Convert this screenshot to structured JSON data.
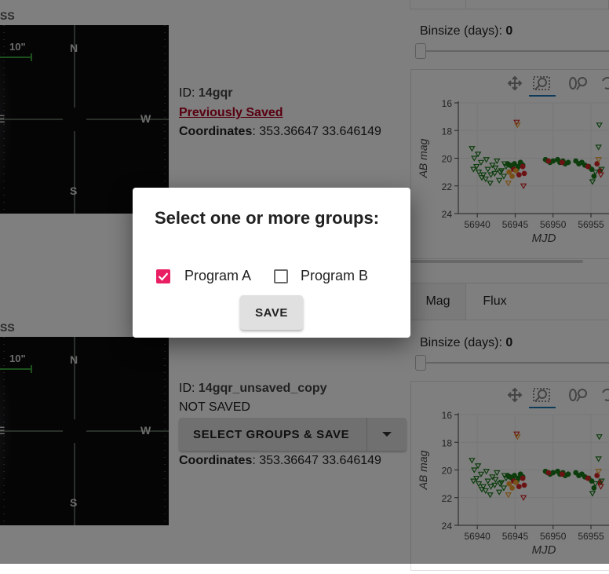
{
  "sources": [
    {
      "thumb_label": "SS",
      "scale_label": "10\"",
      "compass": {
        "n": "N",
        "s": "S",
        "w": "W",
        "e": "E"
      },
      "id_label": "ID:",
      "id_value": "14gqr",
      "status": "Previously Saved",
      "coords_label": "Coordinates",
      "coords_value": ": 353.36647 33.646149"
    },
    {
      "thumb_label": "SS",
      "scale_label": "10\"",
      "compass": {
        "n": "N",
        "s": "S",
        "w": "W",
        "e": "E"
      },
      "id_label": "ID:",
      "id_value": "14gqr_unsaved_copy",
      "status": "NOT SAVED",
      "button_label": "SELECT GROUPS & SAVE",
      "coords_label": "Coordinates",
      "coords_value": ": 353.36647 33.646149"
    }
  ],
  "photometry": [
    {
      "binsize_label": "Binsize (days):",
      "binsize_value": "0",
      "tabs": [],
      "xlabel": "MJD",
      "ylabel": "AB mag"
    },
    {
      "binsize_label": "Binsize (days):",
      "binsize_value": "0",
      "tabs": [
        "Mag",
        "Flux"
      ],
      "xlabel": "MJD",
      "ylabel": "AB mag"
    }
  ],
  "toolbar_icons": [
    "pan-icon",
    "box-zoom-icon",
    "wheel-zoom-icon",
    "reset-icon"
  ],
  "chart_data": {
    "type": "scatter",
    "xlabel": "MJD",
    "ylabel": "AB mag",
    "xlim": [
      56937.5,
      56958
    ],
    "ylim": [
      24,
      16
    ],
    "xticks": [
      56940,
      56945,
      56950,
      56955
    ],
    "yticks": [
      16,
      18,
      20,
      22,
      24
    ],
    "series": [
      {
        "color": "#1b7a1b",
        "marker": "circle",
        "x": [
          56944.0,
          56944.3,
          56944.6,
          56944.9,
          56945.2,
          56945.4,
          56945.7,
          56946.0,
          56949.0,
          56949.3,
          56949.6,
          56950.0,
          56950.6,
          56950.9,
          56951.3,
          56951.6,
          56952.0,
          56953.0,
          56953.4,
          56953.8,
          56954.2,
          56954.7,
          56955.1,
          56955.4
        ],
        "y": [
          20.4,
          20.5,
          20.6,
          20.4,
          20.8,
          20.6,
          20.3,
          20.5,
          20.1,
          20.2,
          20.3,
          20.2,
          20.1,
          20.3,
          20.2,
          20.4,
          20.3,
          20.2,
          20.4,
          20.3,
          20.5,
          20.6,
          20.8,
          21.3
        ]
      },
      {
        "color": "#d62728",
        "marker": "circle",
        "x": [
          56944.8,
          56945.5,
          56946.0,
          56946.2,
          56949.4,
          56951.2,
          56954.6,
          56955.8,
          56956.2
        ],
        "y": [
          20.8,
          21.2,
          20.6,
          21.1,
          20.2,
          20.3,
          20.6,
          20.4,
          20.9
        ]
      },
      {
        "color": "#f0a030",
        "marker": "circle",
        "x": [
          56944.2,
          56944.6,
          56945.1
        ],
        "y": [
          21.0,
          21.3,
          20.9
        ]
      },
      {
        "color": "#1b7a1b",
        "marker": "triangle-down",
        "x": [
          56939.3,
          56939.6,
          56939.9,
          56940.2,
          56940.5,
          56940.8,
          56941.1,
          56941.4,
          56941.7,
          56942.0,
          56942.3,
          56942.6,
          56942.9,
          56943.2,
          56943.5,
          56943.8,
          56939.5,
          56940.1,
          56940.6,
          56941.2,
          56941.8,
          56942.4,
          56943.0,
          56943.6,
          56955.2,
          56955.6,
          56956.0,
          56956.4,
          56956.1
        ],
        "y": [
          19.3,
          20.0,
          20.6,
          21.0,
          20.3,
          21.2,
          21.5,
          20.8,
          21.8,
          20.5,
          21.1,
          20.2,
          21.6,
          20.9,
          21.3,
          20.6,
          20.8,
          19.7,
          21.4,
          20.1,
          21.2,
          20.7,
          21.0,
          20.4,
          21.7,
          21.0,
          19.2,
          20.8,
          17.6
        ]
      },
      {
        "color": "#d62728",
        "marker": "triangle-down",
        "x": [
          56945.2,
          56946.1,
          56956.3
        ],
        "y": [
          17.4,
          22.0,
          21.2
        ]
      },
      {
        "color": "#f0a030",
        "marker": "triangle-down",
        "x": [
          56944.1,
          56945.3,
          56956.0
        ],
        "y": [
          21.8,
          17.6,
          20.1
        ]
      }
    ]
  },
  "dialog": {
    "title": "Select one or more groups:",
    "options": [
      {
        "label": "Program A",
        "checked": true
      },
      {
        "label": "Program B",
        "checked": false
      }
    ],
    "save_label": "SAVE"
  }
}
